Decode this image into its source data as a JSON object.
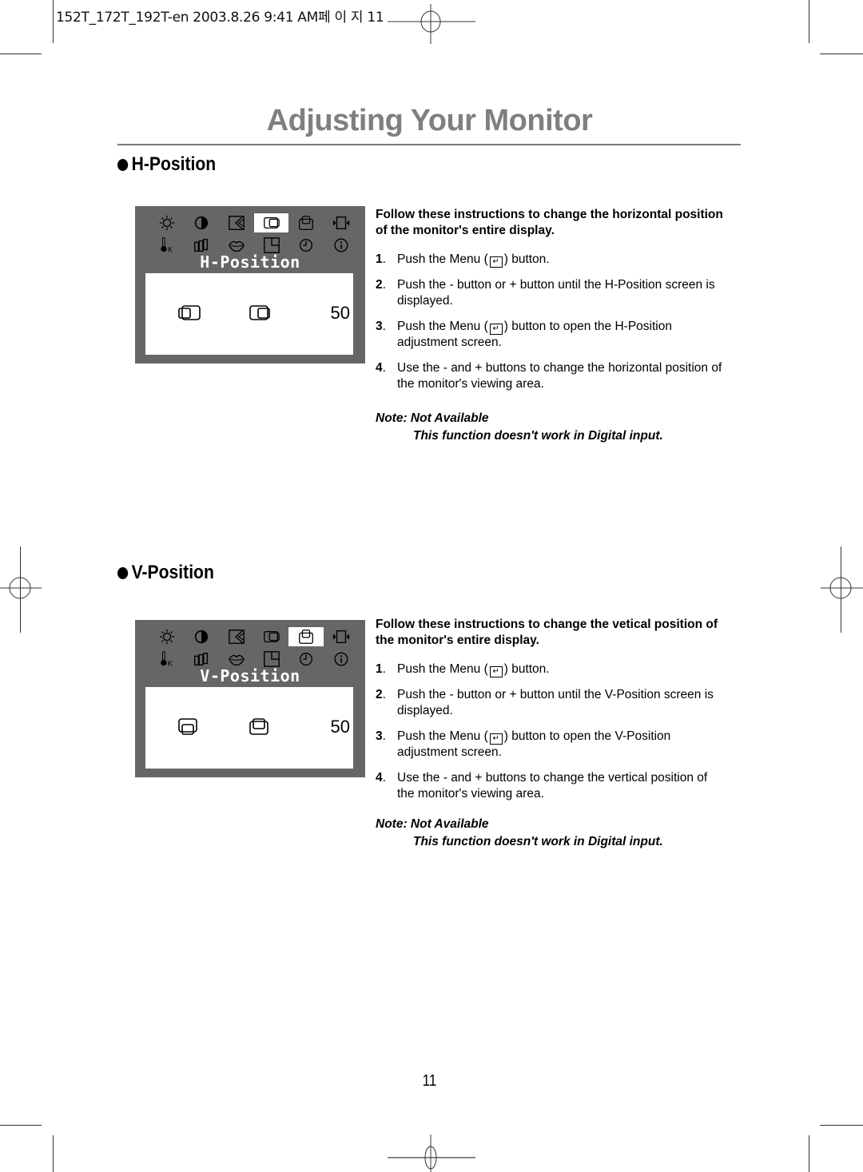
{
  "print_slug": "152T_172T_192T-en  2003.8.26 9:41 AM페 이 지 11",
  "page_title": "Adjusting Your Monitor",
  "page_number": "11",
  "osd_menu_icons": [
    [
      "brightness-icon",
      "contrast-icon",
      "image-lock-icon",
      "h-position-icon",
      "v-position-icon",
      "zoom-icon"
    ],
    [
      "color-temp-icon",
      "color-control-icon",
      "magic-bright-icon",
      "pip-icon",
      "osd-timer-icon",
      "information-icon"
    ]
  ],
  "sections": [
    {
      "heading": "H-Position",
      "osd": {
        "label": "H-Position",
        "selected_icon": "h-position-icon",
        "left_icon": "h-position-left-icon",
        "right_icon": "h-position-right-icon",
        "value": "50"
      },
      "lead": "Follow these instructions to change the horizontal position of the monitor's entire display.",
      "steps": [
        {
          "num": "1",
          "before": "Push the Menu (",
          "after": ") button.",
          "icon": "menu-enter-icon"
        },
        {
          "num": "2",
          "text": "Push the - button or + button until the H-Position screen is displayed."
        },
        {
          "num": "3",
          "before": "Push the Menu (",
          "after": ") button to open the H-Position adjustment screen.",
          "icon": "menu-enter-icon"
        },
        {
          "num": "4",
          "text": "Use the - and + buttons to change the horizontal position of the monitor's viewing area."
        }
      ],
      "note_title": "Note: Not Available",
      "note_body": "This function doesn't work in Digital input."
    },
    {
      "heading": "V-Position",
      "osd": {
        "label": "V-Position",
        "selected_icon": "v-position-icon",
        "left_icon": "v-position-down-icon",
        "right_icon": "v-position-up-icon",
        "value": "50"
      },
      "lead": "Follow these instructions to change the vetical position of the monitor's entire display.",
      "steps": [
        {
          "num": "1",
          "before": "Push the Menu (",
          "after": ") button.",
          "icon": "menu-enter-icon"
        },
        {
          "num": "2",
          "text": "Push the - button or + button until the V-Position screen is displayed."
        },
        {
          "num": "3",
          "before": "Push the Menu (",
          "after": ") button to open the V-Position adjustment screen.",
          "icon": "menu-enter-icon"
        },
        {
          "num": "4",
          "text": "Use the - and + buttons to change the vertical position of the monitor's viewing area."
        }
      ],
      "note_title": "Note: Not Available",
      "note_body": "This function doesn't work in Digital input."
    }
  ]
}
